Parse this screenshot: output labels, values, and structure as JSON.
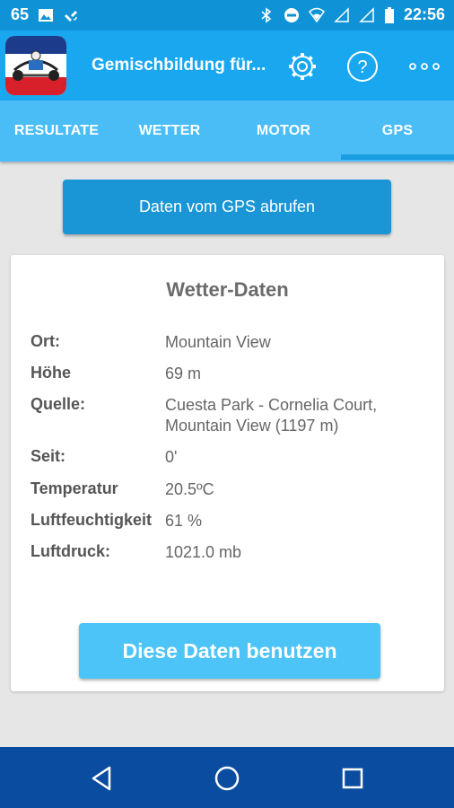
{
  "status_bar": {
    "notification_count": "65",
    "time": "22:56",
    "icons": [
      "image-icon",
      "satellite-icon",
      "bluetooth-icon",
      "do-not-disturb-icon",
      "wifi-icon",
      "signal-icon",
      "signal-icon",
      "battery-icon"
    ]
  },
  "app_bar": {
    "title": "Gemischbildung für...",
    "icons": [
      "settings-icon",
      "help-icon",
      "more-options-icon"
    ]
  },
  "tabs": [
    {
      "label": "RESULTATE",
      "selected": false
    },
    {
      "label": "WETTER",
      "selected": false
    },
    {
      "label": "MOTOR",
      "selected": false
    },
    {
      "label": "GPS",
      "selected": true
    }
  ],
  "fetch_button_label": "Daten vom GPS abrufen",
  "card": {
    "title": "Wetter-Daten",
    "rows": [
      {
        "key": "Ort:",
        "value": "Mountain View"
      },
      {
        "key": "Höhe",
        "value": "69 m"
      },
      {
        "key": "Quelle:",
        "value": "Cuesta Park - Cornelia Court, Mountain View (1197 m)"
      },
      {
        "key": "Seit:",
        "value": "0'"
      },
      {
        "key": "Temperatur",
        "value": "20.5ºC"
      },
      {
        "key": "Luftfeuchtigkeit",
        "value": "61 %"
      },
      {
        "key": "Luftdruck:",
        "value": "1021.0 mb"
      }
    ]
  },
  "use_button_label": "Diese Daten benutzen",
  "nav_bar": {
    "icons": [
      "back-icon",
      "home-icon",
      "recents-icon"
    ]
  },
  "colors": {
    "status_bar": "#0f93d6",
    "app_bar": "#19a7f0",
    "tab_bar": "#4bbdf6",
    "fetch_button": "#1a96d6",
    "use_button": "#4dc4f7",
    "nav_bar": "#0a4da0"
  }
}
